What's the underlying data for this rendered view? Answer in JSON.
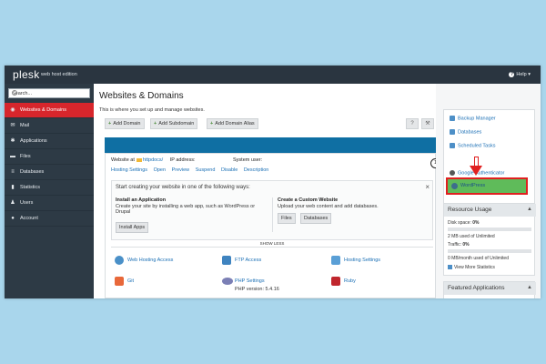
{
  "topbar": {
    "logo": "plesk",
    "edition": "web host edition",
    "help": "Help"
  },
  "sidebar": {
    "search_placeholder": "Search...",
    "items": [
      {
        "label": "Websites & Domains",
        "icon": "globe-icon",
        "active": true
      },
      {
        "label": "Mail",
        "icon": "mail-icon"
      },
      {
        "label": "Applications",
        "icon": "gear-icon"
      },
      {
        "label": "Files",
        "icon": "folder-icon"
      },
      {
        "label": "Databases",
        "icon": "database-icon"
      },
      {
        "label": "Statistics",
        "icon": "statistics-icon"
      },
      {
        "label": "Users",
        "icon": "user-icon"
      },
      {
        "label": "Account",
        "icon": "account-icon"
      }
    ]
  },
  "main": {
    "title": "Websites & Domains",
    "subtitle": "This is where you set up and manage websites.",
    "toolbar": {
      "add_domain": "Add Domain",
      "add_subdomain": "Add Subdomain",
      "add_domain_alias": "Add Domain Alias"
    },
    "site": {
      "website_at_label": "Website at",
      "docroot": "httpdocs/",
      "ip_label": "IP address:",
      "system_user_label": "System user:",
      "actions": [
        "Hosting Settings",
        "Open",
        "Preview",
        "Suspend",
        "Disable",
        "Description"
      ],
      "callout_number": "1"
    },
    "start": {
      "title": "Start creating your website in one of the following ways:",
      "close": "×",
      "install_heading": "Install an Application",
      "install_text": "Create your site by installing a web app, such as WordPress or Drupal",
      "install_button": "Install Apps",
      "custom_heading": "Create a Custom Website",
      "custom_text": "Upload your web content and add databases.",
      "files_button": "Files",
      "databases_button": "Databases"
    },
    "show_less": "SHOW LESS",
    "features": [
      {
        "label": "Web Hosting Access",
        "icon": "hosting-access-icon"
      },
      {
        "label": "FTP Access",
        "icon": "ftp-icon"
      },
      {
        "label": "Hosting Settings",
        "icon": "hosting-settings-icon"
      },
      {
        "label": "Git",
        "icon": "git-icon"
      },
      {
        "label": "PHP Settings",
        "icon": "php-icon"
      },
      {
        "label": "Ruby",
        "icon": "ruby-icon"
      }
    ],
    "php_version": "PHP version: 5.4.16"
  },
  "right": {
    "tools": [
      {
        "label": "Backup Manager"
      },
      {
        "label": "Databases"
      },
      {
        "label": "Scheduled Tasks"
      },
      {
        "label": "Google Authenticator"
      },
      {
        "label": "WordPress"
      }
    ],
    "resource_usage": {
      "title": "Resource Usage",
      "disk_label": "Disk space:",
      "disk_value": "0%",
      "disk_detail": "2 MB used of Unlimited",
      "traffic_label": "Traffic:",
      "traffic_value": "0%",
      "traffic_detail": "0 MB/month used of Unlimited",
      "more_stats": "View More Statistics"
    },
    "featured": {
      "title": "Featured Applications"
    }
  },
  "colors": {
    "topbar": "#2a3540",
    "sidebar": "#2d3a45",
    "active": "#d7262c",
    "link": "#1a6fb5",
    "band": "#0f6fa3",
    "highlight": "#5fbb5a",
    "callout": "#e02020"
  }
}
